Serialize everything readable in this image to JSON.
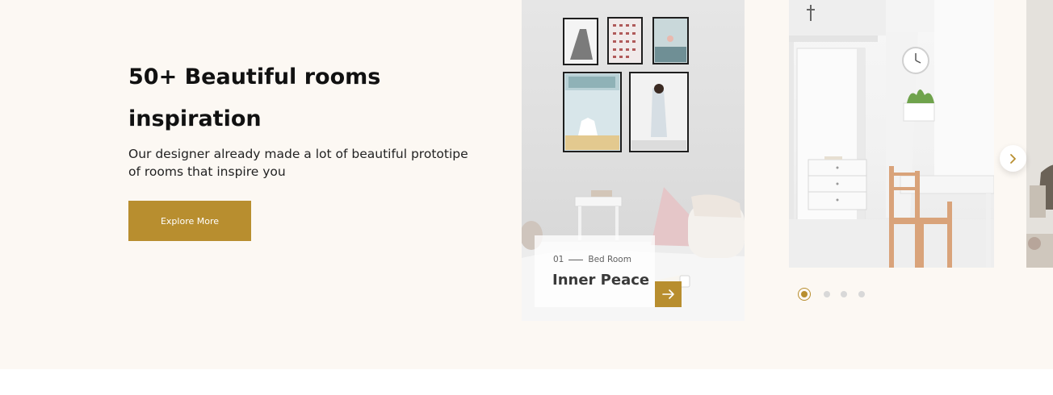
{
  "hero": {
    "title": "50+ Beautiful rooms inspiration",
    "description": "Our designer already made a lot of beautiful prototipe of rooms that inspire you",
    "cta_label": "Explore More"
  },
  "slider": {
    "active_slide": {
      "number": "01",
      "category": "Bed Room",
      "title": "Inner Peace"
    },
    "slides": [
      {
        "image": "bedroom-photo"
      },
      {
        "image": "dining-room-photo"
      },
      {
        "image": "living-room-photo"
      }
    ],
    "next_icon": "chevron-right-icon",
    "go_icon": "arrow-right-icon",
    "dots_count": 4,
    "active_dot": 0
  },
  "colors": {
    "accent": "#b88e2f",
    "section_background": "#fcf8f3",
    "page_background": "#ffffff"
  }
}
